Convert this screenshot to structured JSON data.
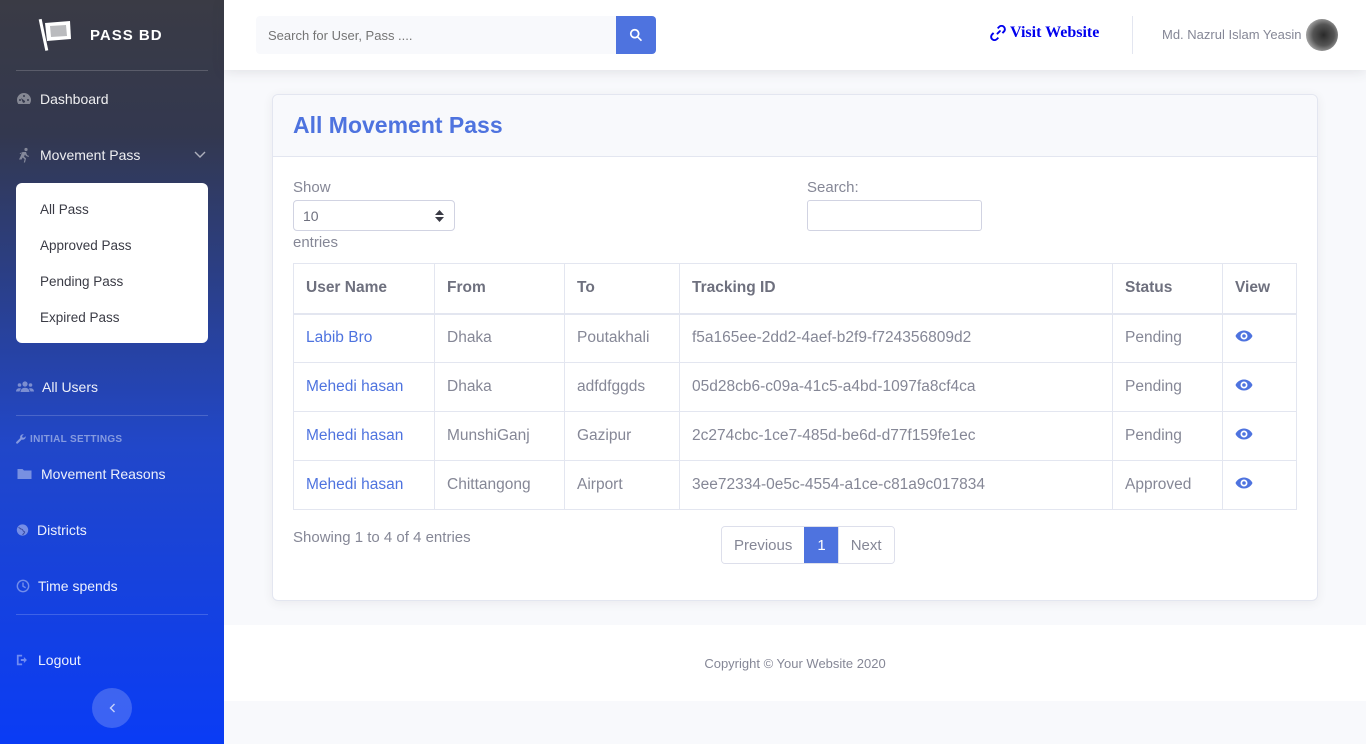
{
  "brand": {
    "name": "PASS BD",
    "icon": "flag-icon"
  },
  "sidebar": {
    "dashboard": "Dashboard",
    "movement_pass": "Movement Pass",
    "submenu": [
      "All Pass",
      "Approved Pass",
      "Pending Pass",
      "Expired Pass"
    ],
    "all_users": "All Users",
    "settings_heading": "INITIAL SETTINGS",
    "movement_reasons": "Movement Reasons",
    "districts": "Districts",
    "time_spends": "Time spends",
    "logout": "Logout"
  },
  "topbar": {
    "search_placeholder": "Search for User, Pass ....",
    "visit_website": "Visit Website",
    "user_name": "Md. Nazrul Islam Yeasin"
  },
  "card": {
    "title": "All Movement Pass",
    "show_label": "Show",
    "page_length": "10",
    "entries_label": "entries",
    "search_label": "Search:",
    "columns": [
      "User Name",
      "From",
      "To",
      "Tracking ID",
      "Status",
      "View"
    ],
    "rows": [
      {
        "user": "Labib Bro",
        "from": "Dhaka",
        "to": "Poutakhali",
        "tracking": "f5a165ee-2dd2-4aef-b2f9-f724356809d2",
        "status": "Pending"
      },
      {
        "user": "Mehedi hasan",
        "from": "Dhaka",
        "to": "adfdfggds",
        "tracking": "05d28cb6-c09a-41c5-a4bd-1097fa8cf4ca",
        "status": "Pending"
      },
      {
        "user": "Mehedi hasan",
        "from": "MunshiGanj",
        "to": "Gazipur",
        "tracking": "2c274cbc-1ce7-485d-be6d-d77f159fe1ec",
        "status": "Pending"
      },
      {
        "user": "Mehedi hasan",
        "from": "Chittangong",
        "to": "Airport",
        "tracking": "3ee72334-0e5c-4554-a1ce-c81a9c017834",
        "status": "Approved"
      }
    ],
    "info": "Showing 1 to 4 of 4 entries",
    "pager": {
      "previous": "Previous",
      "current": "1",
      "next": "Next"
    }
  },
  "footer": {
    "copyright": "Copyright © Your Website 2020"
  },
  "colors": {
    "primary": "#4e73df",
    "sidebar_top": "#3a3b45",
    "sidebar_bottom": "#0a3cf5",
    "link": "#0000ee"
  }
}
